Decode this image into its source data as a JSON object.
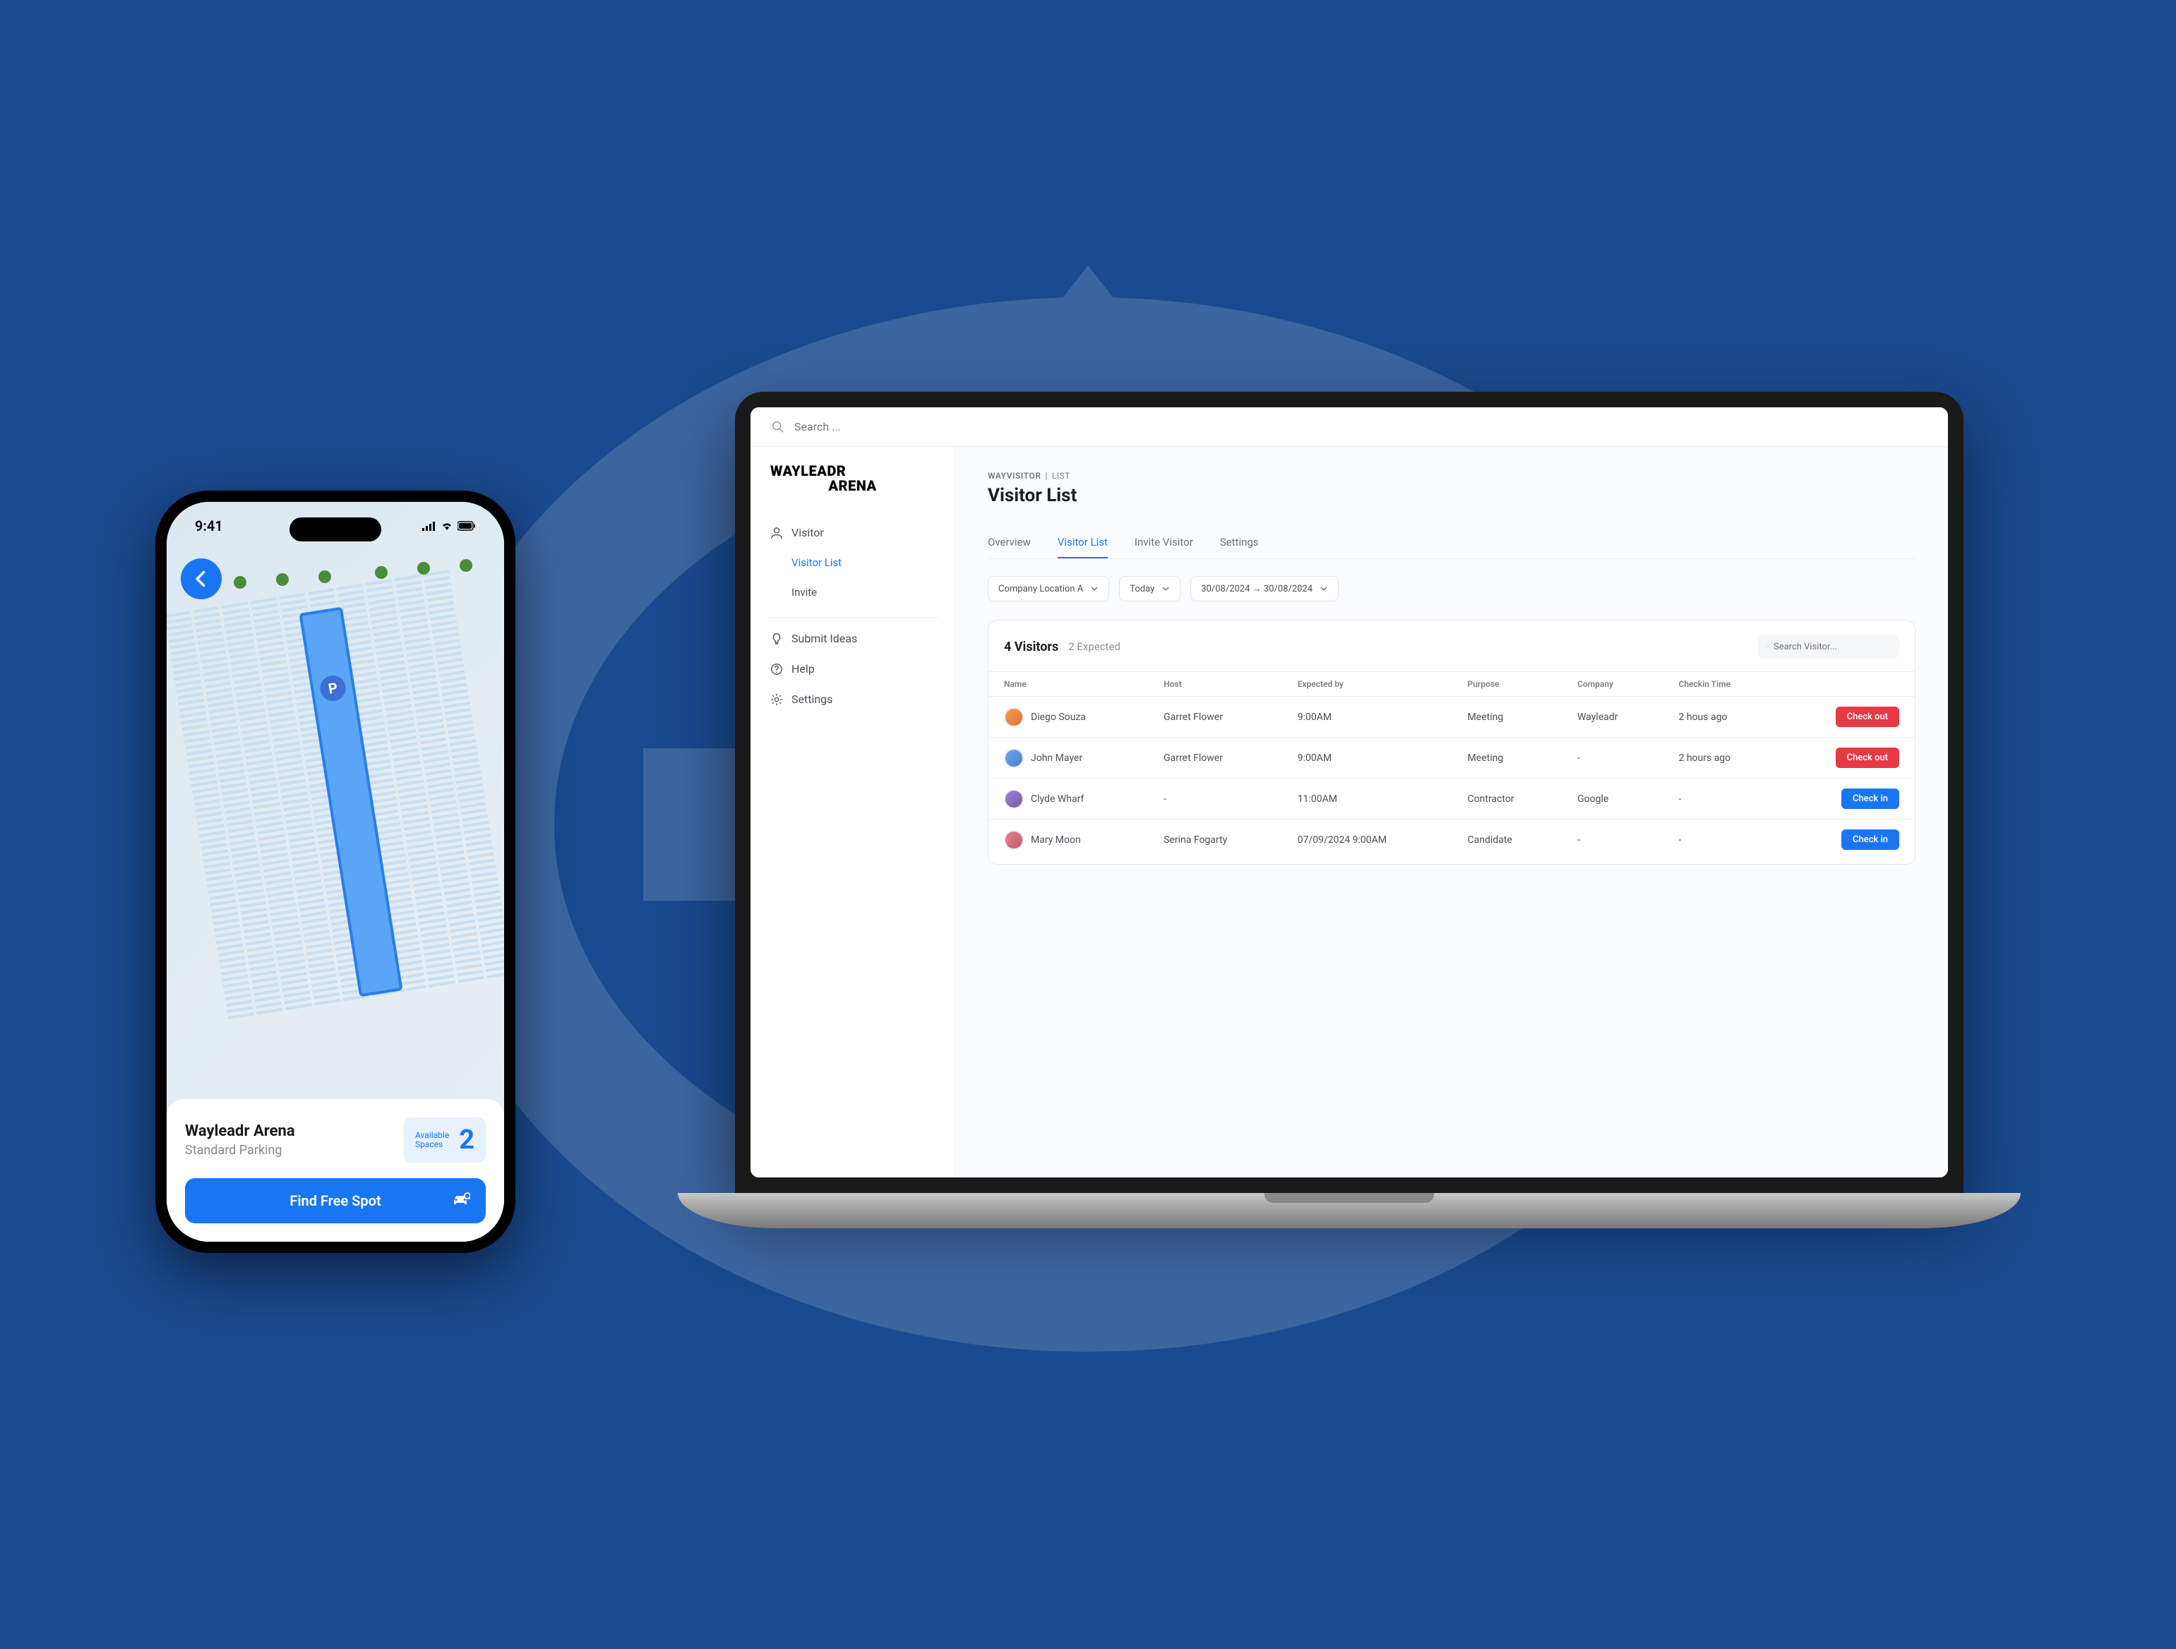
{
  "phone": {
    "status_time": "9:41",
    "card_title": "Wayleadr Arena",
    "card_subtitle": "Standard Parking",
    "badge_label_line1": "Available",
    "badge_label_line2": "Spaces",
    "badge_count": "2",
    "cta_label": "Find Free Spot"
  },
  "laptop": {
    "search_placeholder": "Search ...",
    "logo_line1": "WAYLEADR",
    "logo_line2": "ARENA",
    "sidebar": {
      "visitor": "Visitor",
      "visitor_list": "Visitor List",
      "invite": "Invite",
      "submit_ideas": "Submit Ideas",
      "help": "Help",
      "settings": "Settings"
    },
    "breadcrumb_section": "WAYVISITOR",
    "breadcrumb_page": "List",
    "page_title": "Visitor List",
    "tabs": {
      "overview": "Overview",
      "visitor_list": "Visitor List",
      "invite_visitor": "Invite Visitor",
      "settings": "Settings"
    },
    "filters": {
      "location": "Company Location A",
      "date_preset": "Today",
      "date_range": "30/08/2024 → 30/08/2024"
    },
    "card": {
      "count_label": "4 Visitors",
      "expected_label": "2 Expected",
      "search_placeholder": "Search Visitor..."
    },
    "table": {
      "headers": {
        "name": "Name",
        "host": "Host",
        "expected_by": "Expected by",
        "purpose": "Purpose",
        "company": "Company",
        "checkin_time": "Checkin Time"
      },
      "rows": [
        {
          "name": "Diego Souza",
          "host": "Garret Flower",
          "expected_by": "9:00AM",
          "purpose": "Meeting",
          "company": "Wayleadr",
          "checkin_time": "2 hous ago",
          "action": "Check out",
          "action_type": "checkout"
        },
        {
          "name": "John Mayer",
          "host": "Garret Flower",
          "expected_by": "9:00AM",
          "purpose": "Meeting",
          "company": "-",
          "checkin_time": "2 hours ago",
          "action": "Check out",
          "action_type": "checkout"
        },
        {
          "name": "Clyde Wharf",
          "host": "-",
          "expected_by": "11:00AM",
          "purpose": "Contractor",
          "company": "Google",
          "checkin_time": "-",
          "action": "Check in",
          "action_type": "checkin"
        },
        {
          "name": "Mary Moon",
          "host": "Serina Fogarty",
          "expected_by": "07/09/2024 9:00AM",
          "purpose": "Candidate",
          "company": "-",
          "checkin_time": "-",
          "action": "Check in",
          "action_type": "checkin"
        }
      ]
    }
  }
}
